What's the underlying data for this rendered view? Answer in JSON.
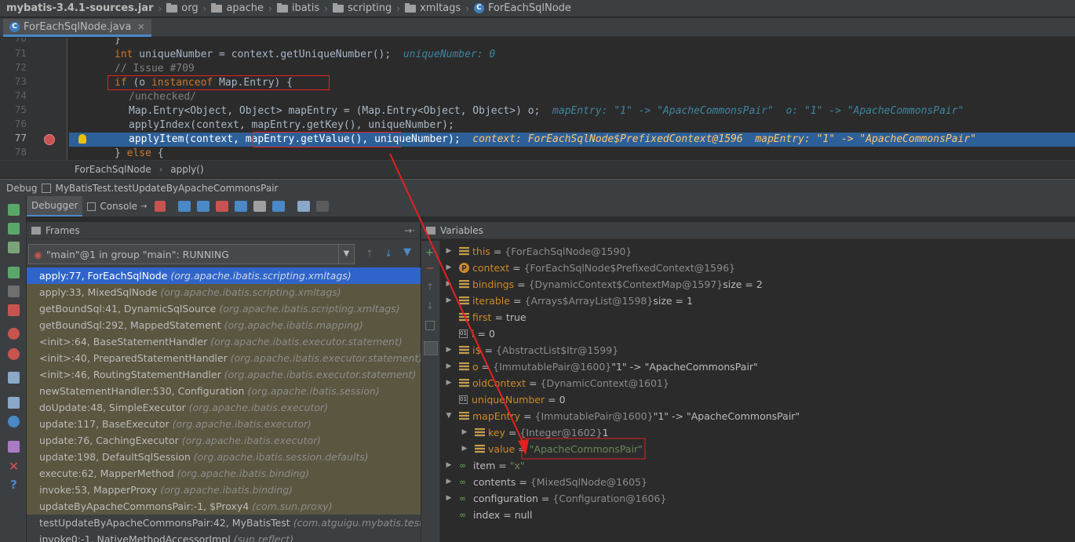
{
  "navbar": {
    "crumbs": [
      "mybatis-3.4.1-sources.jar",
      "org",
      "apache",
      "ibatis",
      "scripting",
      "xmltags",
      "ForEachSqlNode"
    ]
  },
  "editor_tab": {
    "label": "ForEachSqlNode.java"
  },
  "editor": {
    "line_numbers": [
      "70",
      "71",
      "72",
      "73",
      "74",
      "75",
      "76",
      "77",
      "78"
    ],
    "lines": {
      "l70": "}",
      "l71_kw": "int",
      "l71_code": " uniqueNumber = context.getUniqueNumber();  ",
      "l71_hint": "uniqueNumber: 0",
      "l72": "// Issue #709",
      "l73_kw1": "if",
      "l73_mid": " (o ",
      "l73_kw2": "instanceof",
      "l73_end": " Map.Entry) {",
      "l74": "/unchecked/",
      "l75_code": "Map.Entry<Object, Object> mapEntry = (Map.Entry<Object, Object>) o;  ",
      "l75_hint": "mapEntry: \"1\" -> \"ApacheCommonsPair\"  o: \"1\" -> \"ApacheCommonsPair\"",
      "l76": "applyIndex(context, mapEntry.getKey(), uniqueNumber);",
      "l77_code": "applyItem(context, mapEntry.getValue(), uniqueNumber);  ",
      "l77_hint": "context: ForEachSqlNode$PrefixedContext@1596  mapEntry: \"1\" -> \"ApacheCommonsPair\"",
      "l78_code": "} ",
      "l78_kw": "else",
      "l78_end": " {"
    }
  },
  "editor_breadcrumb": {
    "class": "ForEachSqlNode",
    "method": "apply()"
  },
  "debug": {
    "title": "Debug",
    "config": "MyBatisTest.testUpdateByApacheCommonsPair",
    "tabs": {
      "debugger": "Debugger",
      "console": "Console"
    }
  },
  "frames": {
    "title": "Frames",
    "thread": "\"main\"@1 in group \"main\": RUNNING",
    "items": [
      {
        "method": "apply:77, ForEachSqlNode",
        "pkg": "(org.apache.ibatis.scripting.xmltags)"
      },
      {
        "method": "apply:33, MixedSqlNode",
        "pkg": "(org.apache.ibatis.scripting.xmltags)"
      },
      {
        "method": "getBoundSql:41, DynamicSqlSource",
        "pkg": "(org.apache.ibatis.scripting.xmltags)"
      },
      {
        "method": "getBoundSql:292, MappedStatement",
        "pkg": "(org.apache.ibatis.mapping)"
      },
      {
        "method": "<init>:64, BaseStatementHandler",
        "pkg": "(org.apache.ibatis.executor.statement)"
      },
      {
        "method": "<init>:40, PreparedStatementHandler",
        "pkg": "(org.apache.ibatis.executor.statement)"
      },
      {
        "method": "<init>:46, RoutingStatementHandler",
        "pkg": "(org.apache.ibatis.executor.statement)"
      },
      {
        "method": "newStatementHandler:530, Configuration",
        "pkg": "(org.apache.ibatis.session)"
      },
      {
        "method": "doUpdate:48, SimpleExecutor",
        "pkg": "(org.apache.ibatis.executor)"
      },
      {
        "method": "update:117, BaseExecutor",
        "pkg": "(org.apache.ibatis.executor)"
      },
      {
        "method": "update:76, CachingExecutor",
        "pkg": "(org.apache.ibatis.executor)"
      },
      {
        "method": "update:198, DefaultSqlSession",
        "pkg": "(org.apache.ibatis.session.defaults)"
      },
      {
        "method": "execute:62, MapperMethod",
        "pkg": "(org.apache.ibatis.binding)"
      },
      {
        "method": "invoke:53, MapperProxy",
        "pkg": "(org.apache.ibatis.binding)"
      },
      {
        "method": "updateByApacheCommonsPair:-1, $Proxy4",
        "pkg": "(com.sun.proxy)"
      },
      {
        "method": "testUpdateByApacheCommonsPair:42, MyBatisTest",
        "pkg": "(com.atguigu.mybatis.test)"
      },
      {
        "method": "invoke0:-1, NativeMethodAccessorImpl",
        "pkg": "(sun.reflect)"
      }
    ]
  },
  "variables": {
    "title": "Variables",
    "items": [
      {
        "name": "this",
        "value": "{ForEachSqlNode@1590}",
        "extra": ""
      },
      {
        "name": "context",
        "value": "{ForEachSqlNode$PrefixedContext@1596}",
        "extra": ""
      },
      {
        "name": "bindings",
        "value": "{DynamicContext$ContextMap@1597}",
        "extra": " size = 2"
      },
      {
        "name": "iterable",
        "value": "{Arrays$ArrayList@1598}",
        "extra": " size = 1"
      },
      {
        "name": "first",
        "value": "",
        "extra": "true"
      },
      {
        "name": "i",
        "value": "",
        "extra": "0"
      },
      {
        "name": "i$",
        "value": "{AbstractList$Itr@1599}",
        "extra": ""
      },
      {
        "name": "o",
        "value": "{ImmutablePair@1600}",
        "extra": " \"1\" -> \"ApacheCommonsPair\""
      },
      {
        "name": "oldContext",
        "value": "{DynamicContext@1601}",
        "extra": ""
      },
      {
        "name": "uniqueNumber",
        "value": "",
        "extra": "0"
      },
      {
        "name": "mapEntry",
        "value": "{ImmutablePair@1600}",
        "extra": " \"1\" -> \"ApacheCommonsPair\""
      },
      {
        "name": "key",
        "value": "{Integer@1602}",
        "extra": " 1"
      },
      {
        "name": "value",
        "value": "",
        "extra": "\"ApacheCommonsPair\""
      },
      {
        "name": "item",
        "value": "",
        "extra": "\"x\""
      },
      {
        "name": "contents",
        "value": "{MixedSqlNode@1605}",
        "extra": ""
      },
      {
        "name": "configuration",
        "value": "{Configuration@1606}",
        "extra": ""
      },
      {
        "name": "index",
        "value": "",
        "extra": "null"
      }
    ]
  }
}
